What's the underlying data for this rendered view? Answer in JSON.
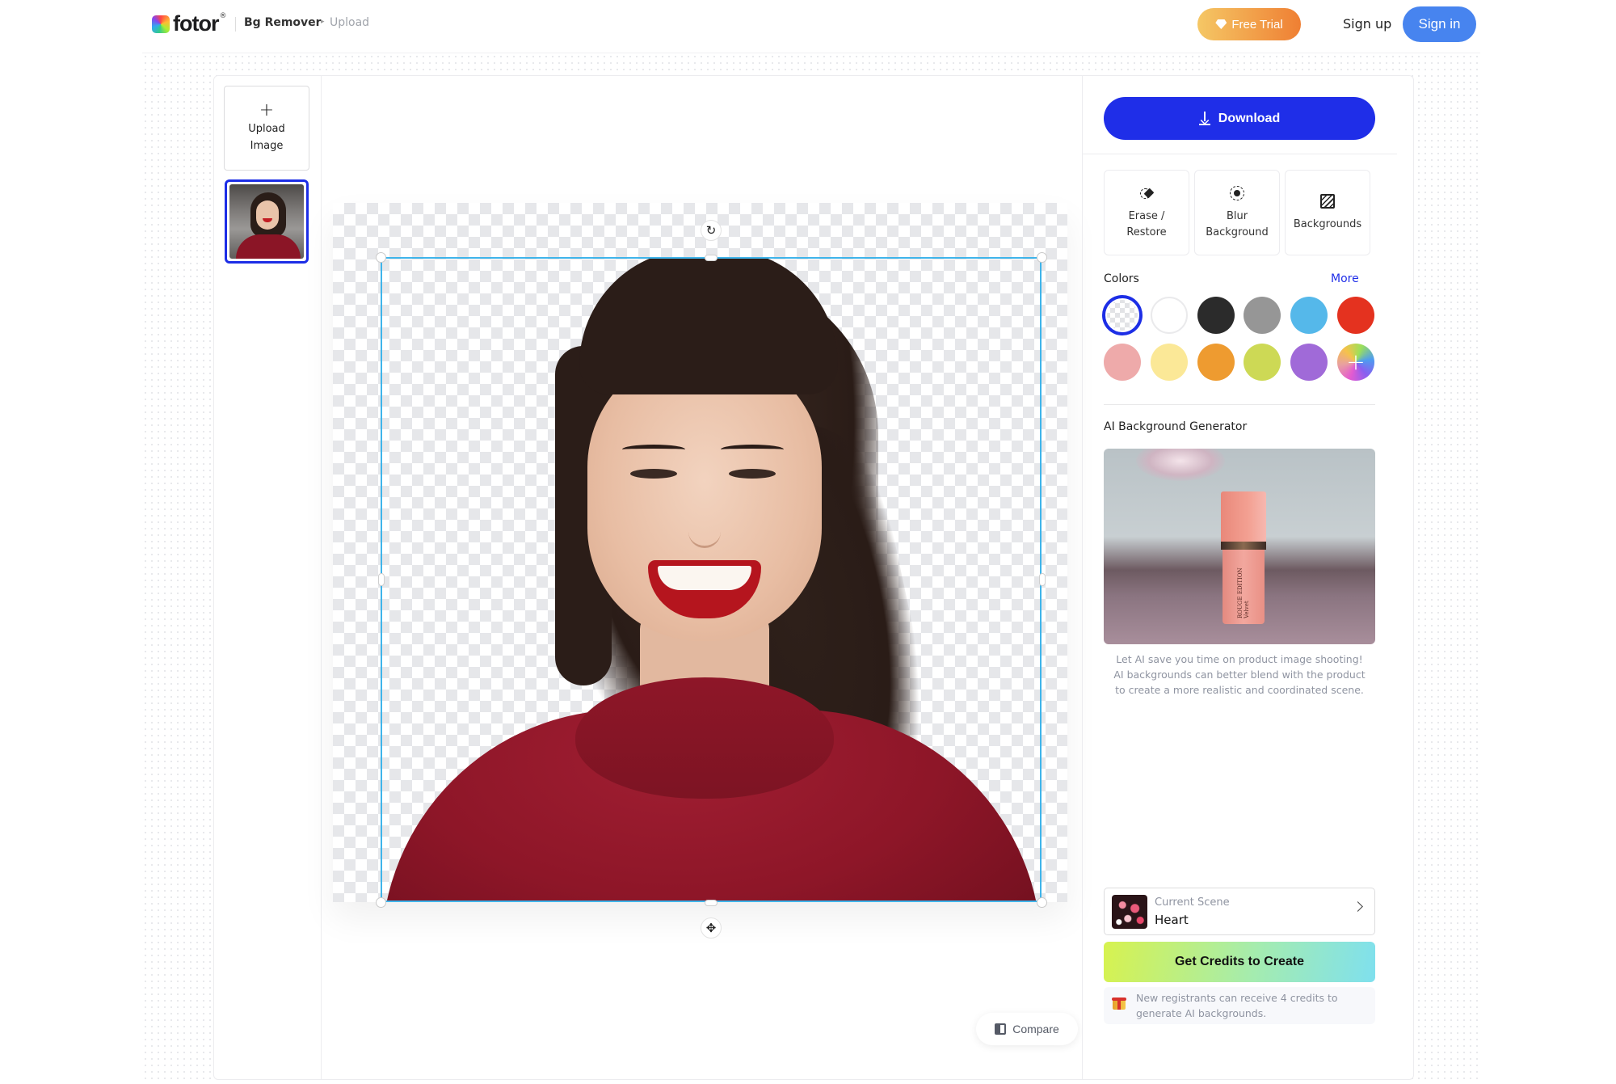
{
  "header": {
    "brand": "fotor",
    "brand_mark": "®",
    "app_name": "Bg Remover",
    "breadcrumb_arrow": "▸",
    "breadcrumb_page": "Upload",
    "free_trial_label": "Free Trial",
    "sign_up_label": "Sign up",
    "sign_in_label": "Sign in"
  },
  "left_strip": {
    "upload_plus": "+",
    "upload_label_line1": "Upload",
    "upload_label_line2": "Image",
    "thumbnails": [
      {
        "name": "woman-red-sweater",
        "selected": true
      }
    ]
  },
  "canvas": {
    "rotate_icon": "↻",
    "move_icon": "✥",
    "compare_label": "Compare"
  },
  "right_panel": {
    "download_label": "Download",
    "tools": [
      {
        "icon": "erase-restore-icon",
        "label_line1": "Erase /",
        "label_line2": "Restore"
      },
      {
        "icon": "blur-background-icon",
        "label_line1": "Blur",
        "label_line2": "Background"
      },
      {
        "icon": "backgrounds-icon",
        "label_line1": "Backgrounds",
        "label_line2": ""
      }
    ],
    "colors_label": "Colors",
    "more_label": "More",
    "colors": [
      {
        "name": "transparent",
        "hex": "transparent",
        "selected": true
      },
      {
        "name": "white",
        "hex": "#ffffff"
      },
      {
        "name": "black",
        "hex": "#2b2b2b"
      },
      {
        "name": "gray",
        "hex": "#969696"
      },
      {
        "name": "sky-blue",
        "hex": "#55b8ea"
      },
      {
        "name": "red",
        "hex": "#e4321f"
      },
      {
        "name": "pink",
        "hex": "#eeaaaa"
      },
      {
        "name": "light-yellow",
        "hex": "#fbe897"
      },
      {
        "name": "orange",
        "hex": "#ee9b30"
      },
      {
        "name": "lime",
        "hex": "#cdd955"
      },
      {
        "name": "purple",
        "hex": "#a06ad8"
      },
      {
        "name": "custom",
        "hex": "gradient",
        "symbol": "+"
      }
    ],
    "ai_section_title": "AI Background Generator",
    "ai_image_caption_text": "ROUGE EDITION Velvet",
    "ai_description": "Let AI save you time on product image shooting! AI backgrounds can better blend with the product to create a more realistic and coordinated scene.",
    "current_scene_label": "Current Scene",
    "current_scene_value": "Heart",
    "get_credits_label": "Get Credits to Create",
    "note_text": "New registrants can receive 4 credits to generate AI backgrounds."
  },
  "colors": {
    "accent_blue": "#1f2ee8",
    "sign_in_blue": "#4784ef",
    "selection_cyan": "#3fb4ea",
    "free_trial_start": "#f5c765",
    "free_trial_end": "#ef7f33"
  }
}
